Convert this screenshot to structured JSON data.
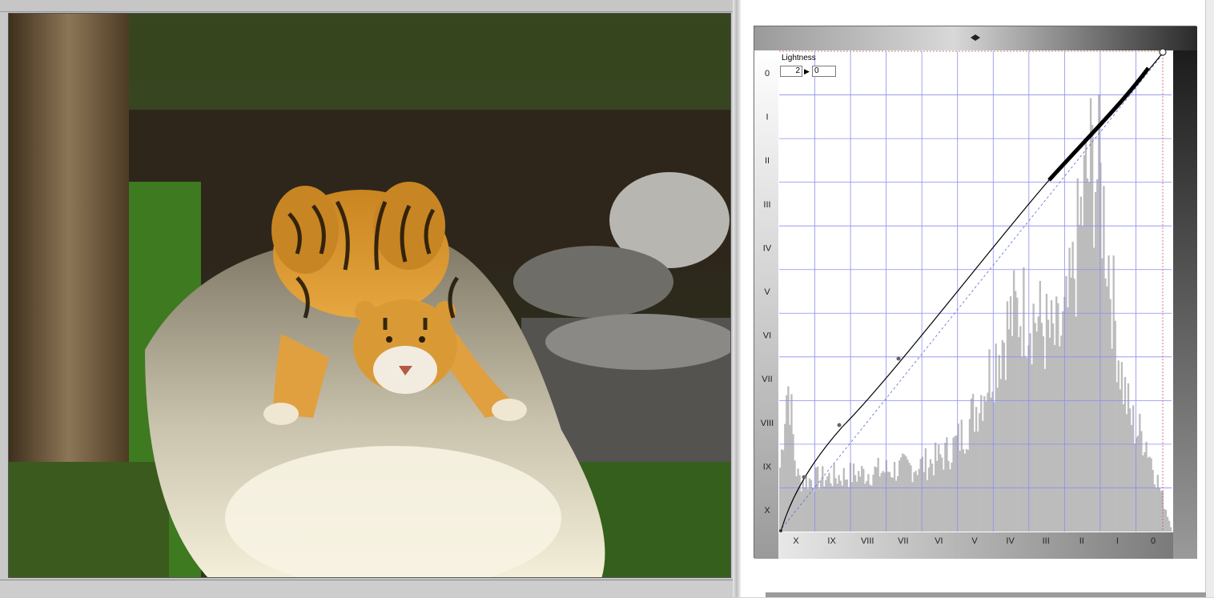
{
  "curves": {
    "channel_label": "Lightness",
    "input_value": "2",
    "output_value": "0",
    "arrow_glyph": "▶",
    "y_zone_labels": [
      "0",
      "I",
      "II",
      "III",
      "IV",
      "V",
      "VI",
      "VII",
      "VIII",
      "IX",
      "X"
    ],
    "x_zone_labels": [
      "X",
      "IX",
      "VIII",
      "VII",
      "VI",
      "V",
      "IV",
      "III",
      "II",
      "I",
      "0"
    ]
  },
  "colors": {
    "grid": "#8c8cf0",
    "histogram": "#bcbcbc",
    "curve": "#000000"
  },
  "icons": {
    "top_arrow": "double-arrow-icon",
    "endpoint": "control-point-icon"
  }
}
